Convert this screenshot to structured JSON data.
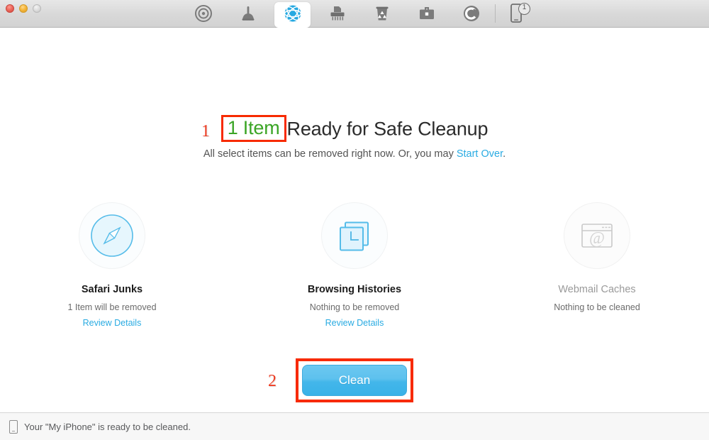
{
  "window": {
    "traffic_lights": [
      "close",
      "minimize",
      "zoom"
    ]
  },
  "toolbar": {
    "tabs": [
      {
        "name": "status-scan",
        "icon": "radar-icon",
        "active": false
      },
      {
        "name": "clean-junk",
        "icon": "plunger-icon",
        "active": false
      },
      {
        "name": "internet-junk",
        "icon": "globe-icon",
        "active": true
      },
      {
        "name": "shredder",
        "icon": "shredder-icon",
        "active": false
      },
      {
        "name": "trash",
        "icon": "trash-recycle-icon",
        "active": false
      },
      {
        "name": "toolkit",
        "icon": "briefcase-icon",
        "active": false
      },
      {
        "name": "uninstaller",
        "icon": "copyright-c-icon",
        "active": false
      }
    ],
    "device": {
      "icon": "iphone-icon",
      "badge": "1"
    }
  },
  "main": {
    "annotation_1": "1",
    "annotation_2": "2",
    "headline_count": "1 Item",
    "headline_rest": "Ready for Safe Cleanup",
    "subtitle_text": "All select items can be removed right now. Or, you may ",
    "subtitle_link": "Start Over",
    "subtitle_end": ".",
    "categories": [
      {
        "icon": "safari-compass-icon",
        "title": "Safari Junks",
        "subtitle": "1 Item will be removed",
        "link": "Review Details",
        "disabled": false,
        "has_link": true
      },
      {
        "icon": "history-clock-icon",
        "title": "Browsing Histories",
        "subtitle": "Nothing to be removed",
        "link": "Review Details",
        "disabled": false,
        "has_link": true
      },
      {
        "icon": "webmail-at-window-icon",
        "title": "Webmail Caches",
        "subtitle": "Nothing to be cleaned",
        "link": "",
        "disabled": true,
        "has_link": false
      }
    ],
    "clean_label": "Clean"
  },
  "statusbar": {
    "icon": "iphone-outline-icon",
    "text": "Your \"My iPhone\" is ready to be cleaned."
  },
  "colors": {
    "accent_blue": "#29abe2",
    "button_blue": "#43b6ea",
    "count_green": "#3ba526",
    "annotation_red": "#f72a00",
    "marker_red": "#ef3b21",
    "disabled_gray": "#9a9a9a"
  }
}
